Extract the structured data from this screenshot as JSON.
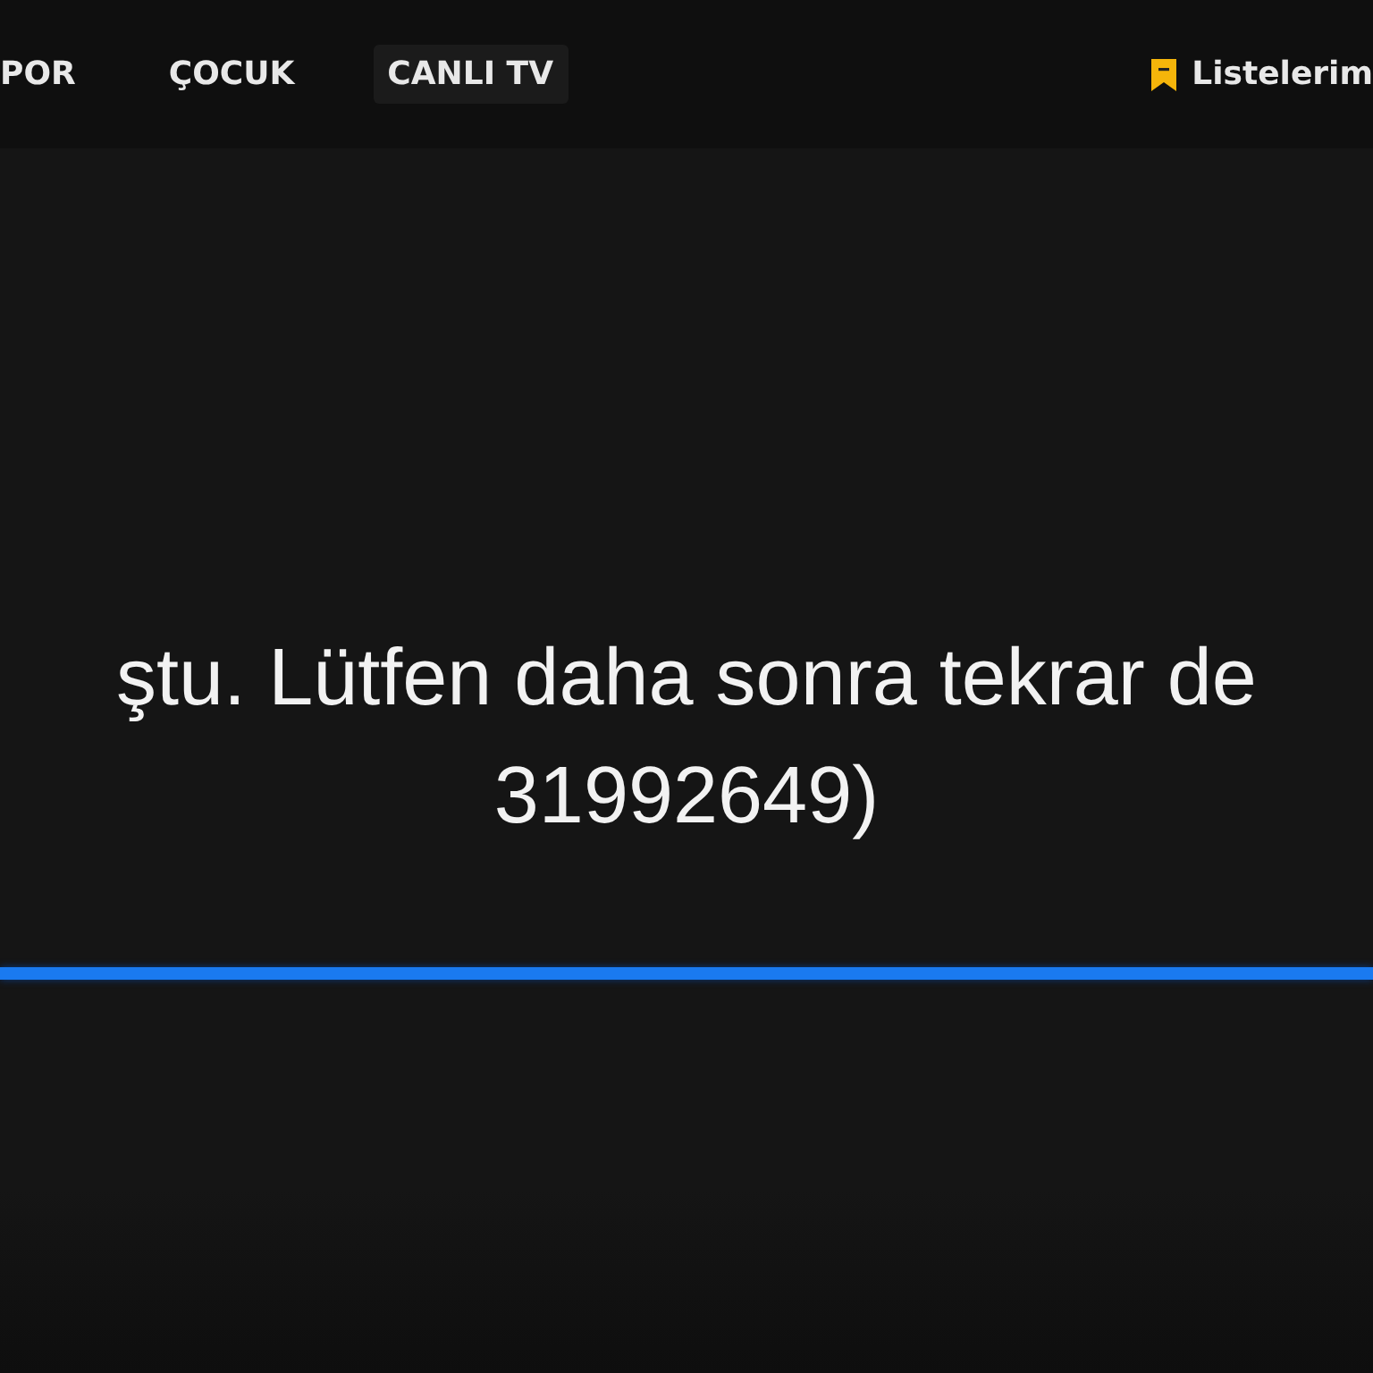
{
  "nav": {
    "items": [
      {
        "label": "POR",
        "selected": false
      },
      {
        "label": "ÇOCUK",
        "selected": false
      },
      {
        "label": "CANLI TV",
        "selected": true
      }
    ],
    "lists_link": {
      "label": "Listelerim"
    }
  },
  "error": {
    "lines": [
      "ştu. Lütfen daha sonra tekrar de",
      "31992649)"
    ]
  }
}
